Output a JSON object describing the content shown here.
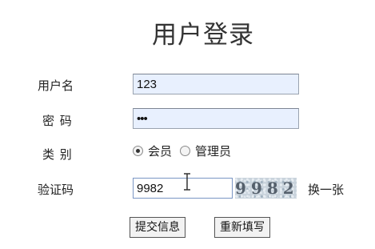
{
  "page": {
    "title": "用户登录"
  },
  "form": {
    "username": {
      "label": "用户名",
      "value": "123"
    },
    "password": {
      "label": "密 码",
      "value": "•••"
    },
    "category": {
      "label": "类 别",
      "options": [
        {
          "label": "会员",
          "selected": true
        },
        {
          "label": "管理员",
          "selected": false
        }
      ]
    },
    "captcha": {
      "label": "验证码",
      "value": "9982",
      "image_text": "9982",
      "refresh_label": "换一张"
    }
  },
  "buttons": {
    "submit_label": "提交信息",
    "reset_label": "重新填写"
  },
  "colors": {
    "autofill_background": "#e8f0fe",
    "focus_border": "#7a96c4",
    "captcha_background": "#c9d3dc"
  },
  "icons": {
    "cursor": "text-cursor-icon"
  }
}
